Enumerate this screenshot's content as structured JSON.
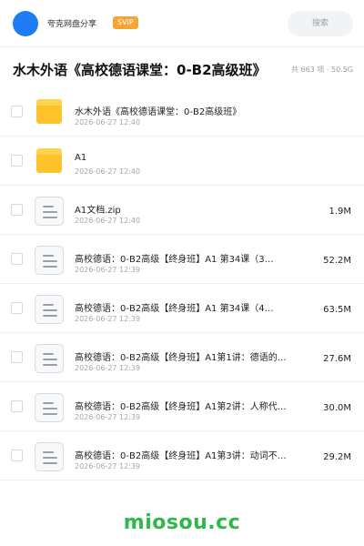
{
  "header": {
    "user_name": "夸克网盘分享",
    "badge": "SVIP",
    "search_label": "搜索"
  },
  "folder": {
    "title": "水木外语《高校德语课堂：0-B2高级班》",
    "meta": "共 663 项 · 50.5G"
  },
  "files": [
    {
      "type": "folder",
      "name": "水木外语《高校德语课堂：0-B2高级班》",
      "date": "2026-06-27 12:40",
      "size": ""
    },
    {
      "type": "folder",
      "name": "A1",
      "date": "2026-06-27 12:40",
      "size": ""
    },
    {
      "type": "file",
      "name": "A1文档.zip",
      "date": "2026-06-27 12:40",
      "size": "1.9M"
    },
    {
      "type": "file",
      "name": "高校德语：0-B2高级【终身班】A1 第34课（3…",
      "date": "2026-06-27 12:39",
      "size": "52.2M"
    },
    {
      "type": "file",
      "name": "高校德语：0-B2高级【终身班】A1 第34课（4…",
      "date": "2026-06-27 12:39",
      "size": "63.5M"
    },
    {
      "type": "file",
      "name": "高校德语：0-B2高级【终身班】A1第1讲：德语的…",
      "date": "2026-06-27 12:39",
      "size": "27.6M"
    },
    {
      "type": "file",
      "name": "高校德语：0-B2高级【终身班】A1第2讲：人称代…",
      "date": "2026-06-27 12:39",
      "size": "30.0M"
    },
    {
      "type": "file",
      "name": "高校德语：0-B2高级【终身班】A1第3讲：动词不…",
      "date": "2026-06-27 12:39",
      "size": "29.2M"
    }
  ],
  "watermark": "miosou.cc",
  "colors": {
    "accent": "#1e7cf5",
    "svip": "#f6a534",
    "folder": "#ffc22b",
    "watermark": "#2fb84a"
  }
}
